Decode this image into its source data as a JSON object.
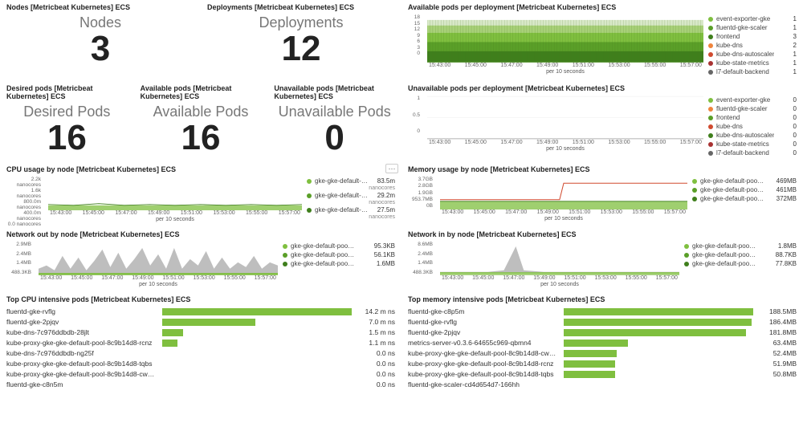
{
  "xaxis": {
    "ticks": [
      "15:43:00",
      "15:45:00",
      "15:47:00",
      "15:49:00",
      "15:51:00",
      "15:53:00",
      "15:55:00",
      "15:57:00"
    ],
    "label": "per 10 seconds"
  },
  "row1": {
    "nodes": {
      "title": "Nodes [Metricbeat Kubernetes] ECS",
      "label": "Nodes",
      "value": "3"
    },
    "deployments": {
      "title": "Deployments [Metricbeat Kubernetes] ECS",
      "label": "Deployments",
      "value": "12"
    },
    "avail_pods_dep": {
      "title": "Available pods per deployment [Metricbeat Kubernetes] ECS",
      "yticks": [
        "18",
        "15",
        "12",
        "9",
        "6",
        "3",
        "0"
      ],
      "legend": [
        {
          "color": "#7fbf3f",
          "label": "event-exporter-gke",
          "val": "1"
        },
        {
          "color": "#5a9f28",
          "label": "fluentd-gke-scaler",
          "val": "1"
        },
        {
          "color": "#3f7f1c",
          "label": "frontend",
          "val": "3"
        },
        {
          "color": "#ef843c",
          "label": "kube-dns",
          "val": "2"
        },
        {
          "color": "#d04a2f",
          "label": "kube-dns-autoscaler",
          "val": "1"
        },
        {
          "color": "#a83232",
          "label": "kube-state-metrics",
          "val": "1"
        },
        {
          "color": "#666",
          "label": "l7-default-backend",
          "val": "1"
        }
      ]
    }
  },
  "row2": {
    "desired": {
      "title": "Desired pods [Metricbeat Kubernetes] ECS",
      "label": "Desired Pods",
      "value": "16"
    },
    "available": {
      "title": "Available pods [Metricbeat Kubernetes] ECS",
      "label": "Available Pods",
      "value": "16"
    },
    "unavailable": {
      "title": "Unavailable pods [Metricbeat Kubernetes] ECS",
      "label": "Unavailable Pods",
      "value": "0"
    },
    "unavail_dep": {
      "title": "Unavailable pods per deployment [Metricbeat Kubernetes] ECS",
      "yticks": [
        "1",
        "0.5",
        "0"
      ],
      "legend": [
        {
          "color": "#7fbf3f",
          "label": "event-exporter-gke",
          "val": "0"
        },
        {
          "color": "#ef843c",
          "label": "fluentd-gke-scaler",
          "val": "0"
        },
        {
          "color": "#5a9f28",
          "label": "frontend",
          "val": "0"
        },
        {
          "color": "#d04a2f",
          "label": "kube-dns",
          "val": "0"
        },
        {
          "color": "#3f7f1c",
          "label": "kube-dns-autoscaler",
          "val": "0"
        },
        {
          "color": "#a83232",
          "label": "kube-state-metrics",
          "val": "0"
        },
        {
          "color": "#666",
          "label": "l7-default-backend",
          "val": "0"
        }
      ]
    }
  },
  "row3": {
    "cpu": {
      "title": "CPU usage by node [Metricbeat Kubernetes] ECS",
      "yticks": [
        "2.2k nanocores",
        "1.6k nanocores",
        "800.0m nanocores",
        "400.0m nanocores",
        "0.0 nanocores"
      ],
      "legend": [
        {
          "color": "#7fbf3f",
          "label": "gke-gke-default-p…",
          "val": "83.5m",
          "sub": "nanocores"
        },
        {
          "color": "#5a9f28",
          "label": "gke-gke-default-p…",
          "val": "29.2m",
          "sub": "nanocores"
        },
        {
          "color": "#3f7f1c",
          "label": "gke-gke-default-p…",
          "val": "27.5m",
          "sub": "nanocores"
        }
      ]
    },
    "mem": {
      "title": "Memory usage by node [Metricbeat Kubernetes] ECS",
      "yticks": [
        "3.7GB",
        "2.8GB",
        "1.9GB",
        "953.7MB",
        "0B"
      ],
      "legend": [
        {
          "color": "#7fbf3f",
          "label": "gke-gke-default-pool-…",
          "val": "469MB"
        },
        {
          "color": "#5a9f28",
          "label": "gke-gke-default-pool-…",
          "val": "461MB"
        },
        {
          "color": "#3f7f1c",
          "label": "gke-gke-default-pool-…",
          "val": "372MB"
        }
      ]
    }
  },
  "row4": {
    "netout": {
      "title": "Network out by node [Metricbeat Kubernetes] ECS",
      "yticks": [
        "2.9MB",
        "2.4MB",
        "1.4MB",
        "488.3KB"
      ],
      "legend": [
        {
          "color": "#7fbf3f",
          "label": "gke-gke-default-pool-…",
          "val": "95.3KB"
        },
        {
          "color": "#5a9f28",
          "label": "gke-gke-default-pool-…",
          "val": "56.1KB"
        },
        {
          "color": "#3f7f1c",
          "label": "gke-gke-default-pool-…",
          "val": "1.6MB"
        }
      ]
    },
    "netin": {
      "title": "Network in by node [Metricbeat Kubernetes] ECS",
      "yticks": [
        "8.6MB",
        "2.4MB",
        "1.4MB",
        "488.3KB"
      ],
      "legend": [
        {
          "color": "#7fbf3f",
          "label": "gke-gke-default-pool-…",
          "val": "1.8MB"
        },
        {
          "color": "#5a9f28",
          "label": "gke-gke-default-pool-…",
          "val": "88.7KB"
        },
        {
          "color": "#3f7f1c",
          "label": "gke-gke-default-pool-…",
          "val": "77.8KB"
        }
      ]
    }
  },
  "row5": {
    "topcpu": {
      "title": "Top CPU intensive pods [Metricbeat Kubernetes] ECS",
      "items": [
        {
          "label": "fluentd-gke-rvflg",
          "val": "14.2 m ns",
          "pct": 100
        },
        {
          "label": "fluentd-gke-2pjqv",
          "val": "7.0 m ns",
          "pct": 49
        },
        {
          "label": "kube-dns-7c976ddbdb-28jlt",
          "val": "1.5 m ns",
          "pct": 11
        },
        {
          "label": "kube-proxy-gke-gke-default-pool-8c9b14d8-rcnz",
          "val": "1.1 m ns",
          "pct": 8
        },
        {
          "label": "kube-dns-7c976ddbdb-ng25f",
          "val": "0.0 ns",
          "pct": 0
        },
        {
          "label": "kube-proxy-gke-gke-default-pool-8c9b14d8-tqbs",
          "val": "0.0 ns",
          "pct": 0
        },
        {
          "label": "kube-proxy-gke-gke-default-pool-8c9b14d8-cw…",
          "val": "0.0 ns",
          "pct": 0
        },
        {
          "label": "fluentd-gke-c8n5m",
          "val": "0.0 ns",
          "pct": 0
        }
      ]
    },
    "topmem": {
      "title": "Top memory intensive pods [Metricbeat Kubernetes] ECS",
      "items": [
        {
          "label": "fluentd-gke-c8p5m",
          "val": "188.5MB",
          "pct": 100
        },
        {
          "label": "fluentd-gke-rvflg",
          "val": "186.4MB",
          "pct": 99
        },
        {
          "label": "fluentd-gke-2pjqv",
          "val": "181.8MB",
          "pct": 96
        },
        {
          "label": "metrics-server-v0.3.6-64655c969-qbmn4",
          "val": "63.4MB",
          "pct": 34
        },
        {
          "label": "kube-proxy-gke-gke-default-pool-8c9b14d8-cw…",
          "val": "52.4MB",
          "pct": 28
        },
        {
          "label": "kube-proxy-gke-gke-default-pool-8c9b14d8-rcnz",
          "val": "51.9MB",
          "pct": 27
        },
        {
          "label": "kube-proxy-gke-gke-default-pool-8c9b14d8-tqbs",
          "val": "50.8MB",
          "pct": 27
        },
        {
          "label": "fluentd-gke-scaler-cd4d654d7-166hh",
          "val": "",
          "pct": 0
        }
      ]
    }
  },
  "chart_data": [
    {
      "type": "area",
      "title": "Available pods per deployment",
      "series": [
        {
          "name": "event-exporter-gke",
          "value": 1
        },
        {
          "name": "fluentd-gke-scaler",
          "value": 1
        },
        {
          "name": "frontend",
          "value": 3
        },
        {
          "name": "kube-dns",
          "value": 2
        },
        {
          "name": "kube-dns-autoscaler",
          "value": 1
        },
        {
          "name": "kube-state-metrics",
          "value": 1
        },
        {
          "name": "l7-default-backend",
          "value": 1
        }
      ],
      "ylim": [
        0,
        18
      ],
      "xlabel": "per 10 seconds"
    },
    {
      "type": "line",
      "title": "Unavailable pods per deployment",
      "series": [
        {
          "name": "event-exporter-gke",
          "value": 0
        },
        {
          "name": "fluentd-gke-scaler",
          "value": 0
        },
        {
          "name": "frontend",
          "value": 0
        },
        {
          "name": "kube-dns",
          "value": 0
        },
        {
          "name": "kube-dns-autoscaler",
          "value": 0
        },
        {
          "name": "kube-state-metrics",
          "value": 0
        },
        {
          "name": "l7-default-backend",
          "value": 0
        }
      ],
      "ylim": [
        0,
        1
      ],
      "xlabel": "per 10 seconds"
    },
    {
      "type": "area",
      "title": "CPU usage by node",
      "series": [
        {
          "name": "gke-gke-default-pool-1",
          "value_m_nanocores": 83.5
        },
        {
          "name": "gke-gke-default-pool-2",
          "value_m_nanocores": 29.2
        },
        {
          "name": "gke-gke-default-pool-3",
          "value_m_nanocores": 27.5
        }
      ],
      "ylim": [
        0,
        2200
      ],
      "yunit": "m nanocores",
      "xlabel": "per 10 seconds"
    },
    {
      "type": "area",
      "title": "Memory usage by node",
      "series": [
        {
          "name": "gke-gke-default-pool-1",
          "value_mb": 469
        },
        {
          "name": "gke-gke-default-pool-2",
          "value_mb": 461
        },
        {
          "name": "gke-gke-default-pool-3",
          "value_mb": 372
        }
      ],
      "ylim": [
        0,
        3700
      ],
      "yunit": "MB",
      "xlabel": "per 10 seconds"
    },
    {
      "type": "area",
      "title": "Network out by node",
      "series": [
        {
          "name": "gke-gke-default-pool-1",
          "value_kb": 95.3
        },
        {
          "name": "gke-gke-default-pool-2",
          "value_kb": 56.1
        },
        {
          "name": "gke-gke-default-pool-3",
          "value_kb": 1638.4
        }
      ],
      "ylim": [
        0,
        2900
      ],
      "yunit": "KB",
      "xlabel": "per 10 seconds"
    },
    {
      "type": "area",
      "title": "Network in by node",
      "series": [
        {
          "name": "gke-gke-default-pool-1",
          "value_kb": 1843.2
        },
        {
          "name": "gke-gke-default-pool-2",
          "value_kb": 88.7
        },
        {
          "name": "gke-gke-default-pool-3",
          "value_kb": 77.8
        }
      ],
      "ylim": [
        0,
        8600
      ],
      "yunit": "KB",
      "xlabel": "per 10 seconds"
    },
    {
      "type": "bar",
      "title": "Top CPU intensive pods",
      "categories": [
        "fluentd-gke-rvflg",
        "fluentd-gke-2pjqv",
        "kube-dns-7c976ddbdb-28jlt",
        "kube-proxy-…-rcnz",
        "kube-dns-7c976ddbdb-ng25f",
        "kube-proxy-…-tqbs",
        "kube-proxy-…-cw",
        "fluentd-gke-c8n5m"
      ],
      "values": [
        14.2,
        7.0,
        1.5,
        1.1,
        0,
        0,
        0,
        0
      ],
      "unit": "m ns"
    },
    {
      "type": "bar",
      "title": "Top memory intensive pods",
      "categories": [
        "fluentd-gke-c8p5m",
        "fluentd-gke-rvflg",
        "fluentd-gke-2pjqv",
        "metrics-server-v0.3.6-…",
        "kube-proxy-…-cw",
        "kube-proxy-…-rcnz",
        "kube-proxy-…-tqbs",
        "fluentd-gke-scaler-…"
      ],
      "values": [
        188.5,
        186.4,
        181.8,
        63.4,
        52.4,
        51.9,
        50.8,
        0
      ],
      "unit": "MB"
    }
  ]
}
